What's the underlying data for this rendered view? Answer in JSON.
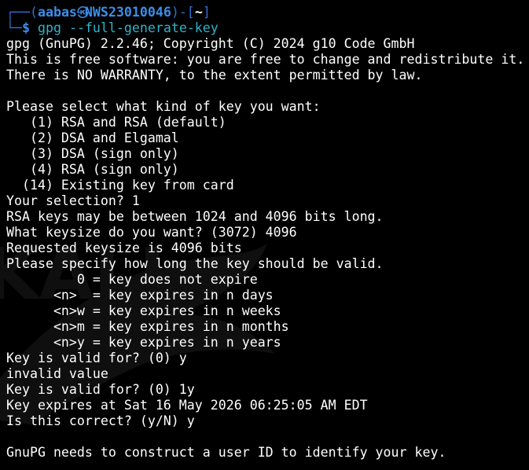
{
  "prompt": {
    "frame_top_left": "┌──(",
    "user": "aabas",
    "separator_icon": "kali-skull-icon",
    "separator_glyph": "㉿",
    "host": "NWS23010046",
    "frame_mid": ")-[",
    "cwd": "~",
    "frame_close": "]",
    "frame_bottom_left": "└─",
    "dollar": "$"
  },
  "command": {
    "name": "gpg",
    "args": " --full-generate-key"
  },
  "output": [
    "gpg (GnuPG) 2.2.46; Copyright (C) 2024 g10 Code GmbH",
    "This is free software: you are free to change and redistribute it.",
    "There is NO WARRANTY, to the extent permitted by law.",
    "",
    "Please select what kind of key you want:",
    "   (1) RSA and RSA (default)",
    "   (2) DSA and Elgamal",
    "   (3) DSA (sign only)",
    "   (4) RSA (sign only)",
    "  (14) Existing key from card",
    "Your selection? 1",
    "RSA keys may be between 1024 and 4096 bits long.",
    "What keysize do you want? (3072) 4096",
    "Requested keysize is 4096 bits",
    "Please specify how long the key should be valid.",
    "         0 = key does not expire",
    "      <n>  = key expires in n days",
    "      <n>w = key expires in n weeks",
    "      <n>m = key expires in n months",
    "      <n>y = key expires in n years",
    "Key is valid for? (0) y",
    "invalid value",
    "Key is valid for? (0) 1y",
    "Key expires at Sat 16 May 2026 06:25:05 AM EDT",
    "Is this correct? (y/N) y",
    "",
    "GnuPG needs to construct a user ID to identify your key."
  ],
  "colors": {
    "background": "#000000",
    "prompt_frame": "#2f6fd6",
    "prompt_user": "#3b8eea",
    "command": "#2fb3c9",
    "text": "#ffffff"
  }
}
